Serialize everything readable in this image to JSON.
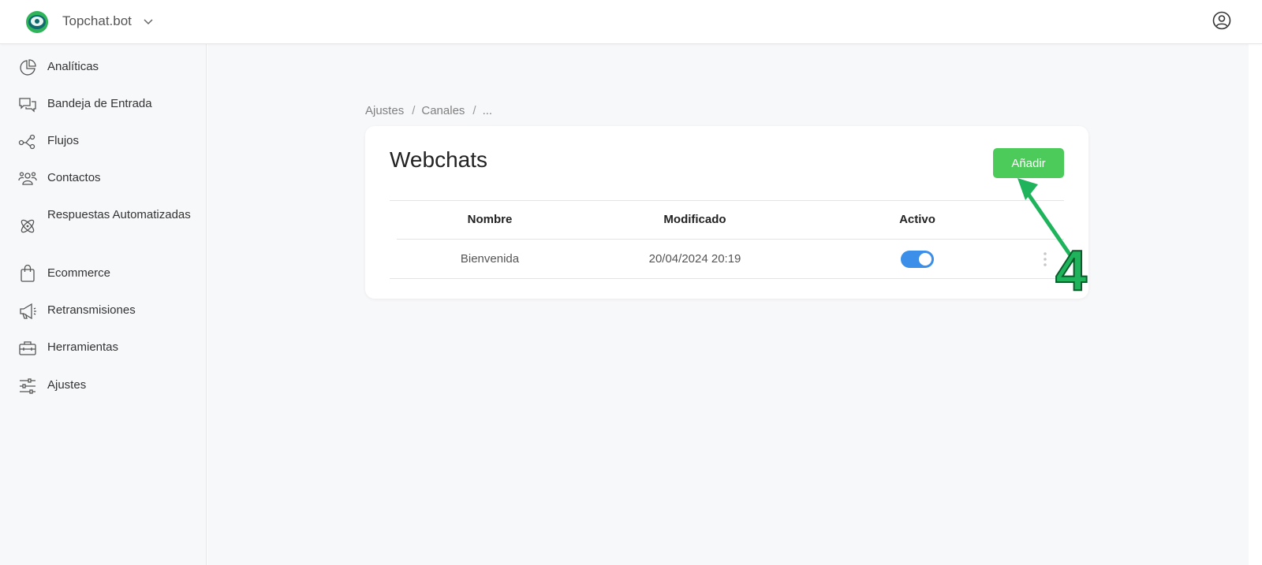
{
  "header": {
    "brand": "Topchat.bot"
  },
  "sidebar": {
    "items": [
      {
        "label": "Analíticas",
        "icon": "pie-chart-icon"
      },
      {
        "label": "Bandeja de Entrada",
        "icon": "chat-bubbles-icon"
      },
      {
        "label": "Flujos",
        "icon": "flow-icon"
      },
      {
        "label": "Contactos",
        "icon": "contacts-icon"
      },
      {
        "label": "Respuestas Automatizadas",
        "icon": "atom-icon"
      },
      {
        "label": "Ecommerce",
        "icon": "shopping-bag-icon"
      },
      {
        "label": "Retransmisiones",
        "icon": "megaphone-icon"
      },
      {
        "label": "Herramientas",
        "icon": "toolbox-icon"
      },
      {
        "label": "Ajustes",
        "icon": "sliders-icon"
      }
    ]
  },
  "breadcrumb": {
    "items": [
      "Ajustes",
      "Canales",
      "..."
    ],
    "separator": "/"
  },
  "card": {
    "title": "Webchats",
    "add_label": "Añadir"
  },
  "table": {
    "headers": [
      "Nombre",
      "Modificado",
      "Activo"
    ],
    "rows": [
      {
        "nombre": "Bienvenida",
        "modificado": "20/04/2024 20:19",
        "activo": true
      }
    ]
  },
  "annotation": {
    "label": "4"
  },
  "colors": {
    "accent_green": "#4cca5a",
    "toggle_blue": "#3b8fe8",
    "annotation_green": "#1fb45c"
  }
}
